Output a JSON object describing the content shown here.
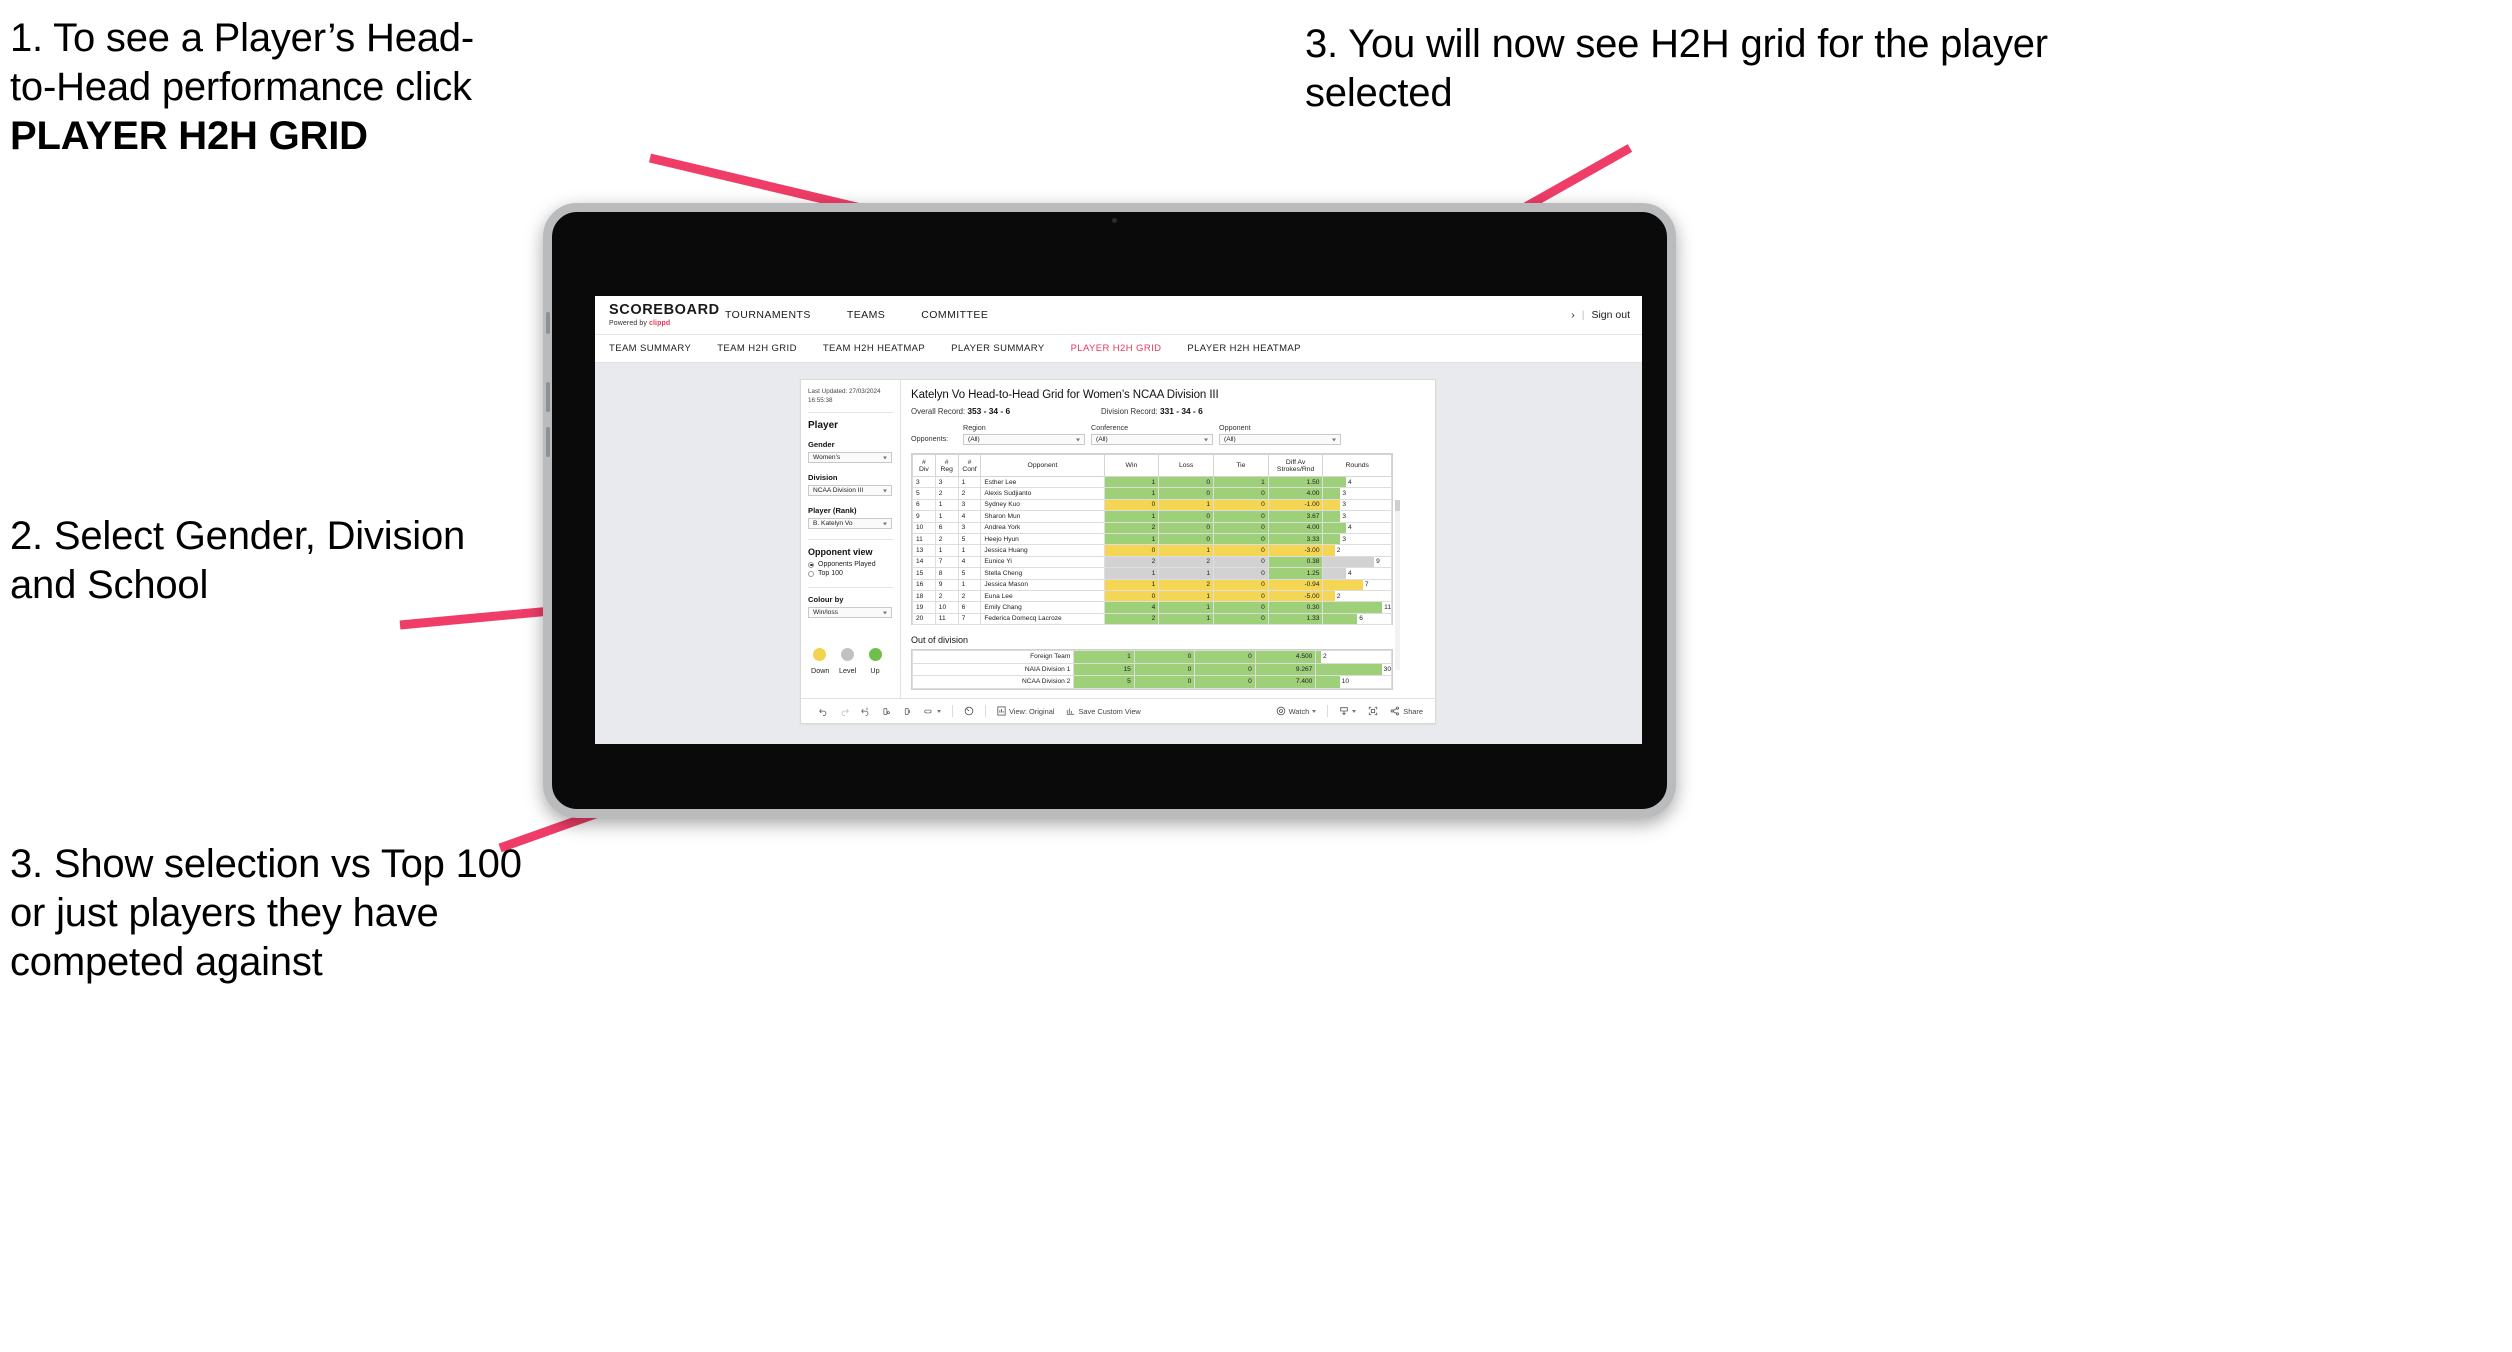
{
  "annotations": {
    "a1_line1": "1. To see a Player’s Head-",
    "a1_line2": "to-Head performance click",
    "a1_bold": "PLAYER H2H GRID",
    "a2": "2. Select Gender, Division and School",
    "a3": "3. Show selection vs Top 100 or just players they have competed against",
    "a4": "3. You will now see H2H grid for the player selected",
    "accent_color": "#ef3d68"
  },
  "app": {
    "brand_name": "SCOREBOARD",
    "brand_sub_prefix": "Powered by ",
    "brand_sub_clippd": "clippd",
    "main_nav": [
      "TOURNAMENTS",
      "TEAMS",
      "COMMITTEE"
    ],
    "sign_out": "Sign out",
    "sub_nav": [
      {
        "label": "TEAM SUMMARY",
        "active": false
      },
      {
        "label": "TEAM H2H GRID",
        "active": false
      },
      {
        "label": "TEAM H2H HEATMAP",
        "active": false
      },
      {
        "label": "PLAYER SUMMARY",
        "active": false
      },
      {
        "label": "PLAYER H2H GRID",
        "active": true
      },
      {
        "label": "PLAYER H2H HEATMAP",
        "active": false
      }
    ],
    "active_tab_color": "#e8395c"
  },
  "pane": {
    "last_updated": "Last Updated: 27/03/2024 16:55:38",
    "player_heading": "Player",
    "gender_label": "Gender",
    "gender_value": "Women's",
    "division_label": "Division",
    "division_value": "NCAA Division III",
    "player_rank_label": "Player (Rank)",
    "player_rank_value": "B. Katelyn Vo",
    "opponent_view_heading": "Opponent view",
    "opponent_view_options": [
      {
        "label": "Opponents Played",
        "selected": true
      },
      {
        "label": "Top 100",
        "selected": false
      }
    ],
    "colour_by_label": "Colour by",
    "colour_by_value": "Win/loss",
    "legend": [
      {
        "label": "Down",
        "color": "#f3d24e"
      },
      {
        "label": "Level",
        "color": "#bfc2c4"
      },
      {
        "label": "Up",
        "color": "#6fbf4a"
      }
    ]
  },
  "content": {
    "title": "Katelyn Vo Head-to-Head Grid for Women’s NCAA Division III",
    "overall_record_label": "Overall Record:",
    "overall_record_value": "353 - 34 - 6",
    "division_record_label": "Division Record:",
    "division_record_value": "331 - 34 - 6",
    "opponents_label": "Opponents:",
    "filters": [
      {
        "caption": "Region",
        "value": "(All)"
      },
      {
        "caption": "Conference",
        "value": "(All)"
      },
      {
        "caption": "Opponent",
        "value": "(All)"
      }
    ],
    "out_of_division_heading": "Out of division"
  },
  "chart_data": {
    "type": "table",
    "title": "Katelyn Vo Head-to-Head Grid for Women’s NCAA Division III",
    "columns": [
      "# Div",
      "# Reg",
      "# Conf",
      "Opponent",
      "Win",
      "Loss",
      "Tie",
      "Diff Av Strokes/Rnd",
      "Rounds"
    ],
    "column_headers_split": [
      {
        "l1": "#",
        "l2": "Div"
      },
      {
        "l1": "#",
        "l2": "Reg"
      },
      {
        "l1": "#",
        "l2": "Conf"
      },
      {
        "l1": "Opponent",
        "l2": ""
      },
      {
        "l1": "Win",
        "l2": ""
      },
      {
        "l1": "Loss",
        "l2": ""
      },
      {
        "l1": "Tie",
        "l2": ""
      },
      {
        "l1": "Diff Av",
        "l2": "Strokes/Rnd"
      },
      {
        "l1": "Rounds",
        "l2": ""
      }
    ],
    "rounds_max": 12,
    "rows": [
      {
        "div": "3",
        "reg": "3",
        "conf": "1",
        "opponent": "Esther Lee",
        "win": "1",
        "loss": "0",
        "tie": "1",
        "diff": "1.50",
        "rounds": "4",
        "color": "g"
      },
      {
        "div": "5",
        "reg": "2",
        "conf": "2",
        "opponent": "Alexis Sudjianto",
        "win": "1",
        "loss": "0",
        "tie": "0",
        "diff": "4.00",
        "rounds": "3",
        "color": "g"
      },
      {
        "div": "6",
        "reg": "1",
        "conf": "3",
        "opponent": "Sydney Kuo",
        "win": "0",
        "loss": "1",
        "tie": "0",
        "diff": "-1.00",
        "rounds": "3",
        "color": "y"
      },
      {
        "div": "9",
        "reg": "1",
        "conf": "4",
        "opponent": "Sharon Mun",
        "win": "1",
        "loss": "0",
        "tie": "0",
        "diff": "3.67",
        "rounds": "3",
        "color": "g"
      },
      {
        "div": "10",
        "reg": "6",
        "conf": "3",
        "opponent": "Andrea York",
        "win": "2",
        "loss": "0",
        "tie": "0",
        "diff": "4.00",
        "rounds": "4",
        "color": "g"
      },
      {
        "div": "11",
        "reg": "2",
        "conf": "5",
        "opponent": "Heejo Hyun",
        "win": "1",
        "loss": "0",
        "tie": "0",
        "diff": "3.33",
        "rounds": "3",
        "color": "g"
      },
      {
        "div": "13",
        "reg": "1",
        "conf": "1",
        "opponent": "Jessica Huang",
        "win": "0",
        "loss": "1",
        "tie": "0",
        "diff": "-3.00",
        "rounds": "2",
        "color": "y"
      },
      {
        "div": "14",
        "reg": "7",
        "conf": "4",
        "opponent": "Eunice Yi",
        "win": "2",
        "loss": "2",
        "tie": "0",
        "diff": "0.38",
        "rounds": "9",
        "color": "gr",
        "diff_color": "g"
      },
      {
        "div": "15",
        "reg": "8",
        "conf": "5",
        "opponent": "Stella Cheng",
        "win": "1",
        "loss": "1",
        "tie": "0",
        "diff": "1.25",
        "rounds": "4",
        "color": "gr",
        "diff_color": "g"
      },
      {
        "div": "16",
        "reg": "9",
        "conf": "1",
        "opponent": "Jessica Mason",
        "win": "1",
        "loss": "2",
        "tie": "0",
        "diff": "-0.94",
        "rounds": "7",
        "color": "y"
      },
      {
        "div": "18",
        "reg": "2",
        "conf": "2",
        "opponent": "Euna Lee",
        "win": "0",
        "loss": "1",
        "tie": "0",
        "diff": "-5.00",
        "rounds": "2",
        "color": "y"
      },
      {
        "div": "19",
        "reg": "10",
        "conf": "6",
        "opponent": "Emily Chang",
        "win": "4",
        "loss": "1",
        "tie": "0",
        "diff": "0.30",
        "rounds": "11",
        "color": "g"
      },
      {
        "div": "20",
        "reg": "11",
        "conf": "7",
        "opponent": "Federica Domecq Lacroze",
        "win": "2",
        "loss": "1",
        "tie": "0",
        "diff": "1.33",
        "rounds": "6",
        "color": "g"
      }
    ],
    "out_of_division_rounds_max": 32,
    "out_of_division": [
      {
        "name": "Foreign Team",
        "win": "1",
        "loss": "0",
        "tie": "0",
        "diff": "4.500",
        "rounds": "2",
        "color": "g"
      },
      {
        "name": "NAIA Division 1",
        "win": "15",
        "loss": "0",
        "tie": "0",
        "diff": "9.267",
        "rounds": "30",
        "color": "g"
      },
      {
        "name": "NCAA Division 2",
        "win": "5",
        "loss": "0",
        "tie": "0",
        "diff": "7.400",
        "rounds": "10",
        "color": "g"
      }
    ]
  },
  "toolbar": {
    "view_label": "View: Original",
    "save_label": "Save Custom View",
    "watch_label": "Watch",
    "share_label": "Share"
  }
}
